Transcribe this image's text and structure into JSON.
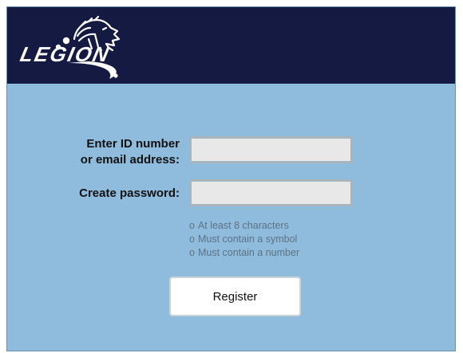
{
  "header": {
    "logo_text": "LEGION",
    "colors": {
      "background": "#141a42",
      "logo": "#ffffff"
    }
  },
  "form": {
    "id_label_line1": "Enter ID number",
    "id_label_line2": "or email address:",
    "id_value": "",
    "password_label": "Create password:",
    "password_value": ""
  },
  "password_rules": {
    "bullet": "o",
    "items": [
      "At least 8 characters",
      "Must contain a symbol",
      "Must contain a number"
    ],
    "color": "#5c7284"
  },
  "actions": {
    "register_label": "Register"
  },
  "colors": {
    "page_background": "#8fbcdc",
    "input_background": "#e8e8e8",
    "button_background": "#ffffff"
  }
}
